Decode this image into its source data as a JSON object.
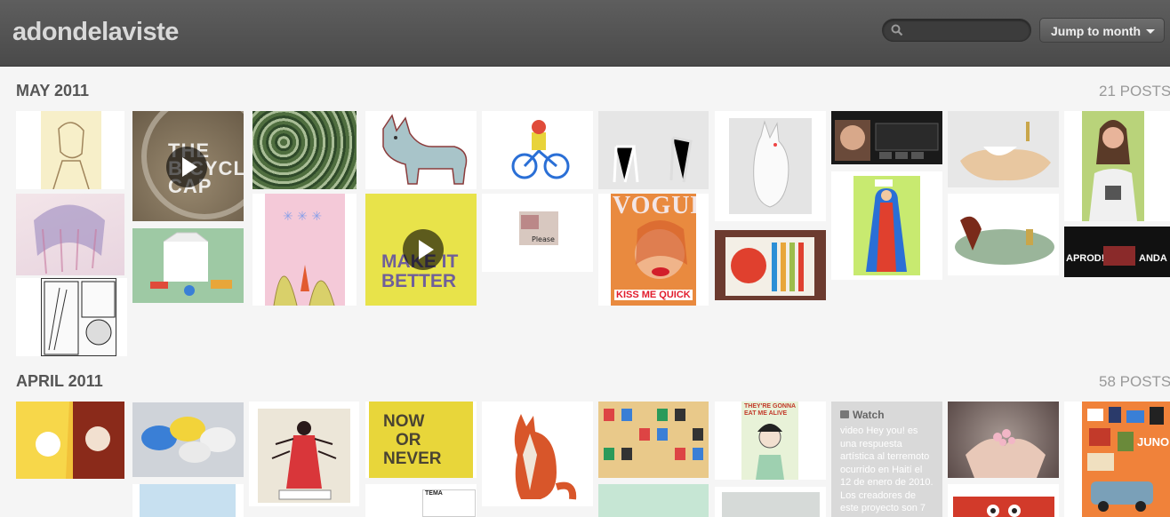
{
  "header": {
    "site_title": "adondelaviste",
    "search_placeholder": "",
    "jump_label": "Jump to month"
  },
  "sections": [
    {
      "title": "MAY 2011",
      "count": "21 POSTS"
    },
    {
      "title": "APRIL 2011",
      "count": "58 POSTS"
    }
  ],
  "tile_text": {
    "bicycle": "THE BICYCLE CAP",
    "vogue_masthead": "VOGUE",
    "vogue_cover": "KISS ME QUICK",
    "make_it_better": "MAKE IT BETTER",
    "now_or_never": [
      "NOW",
      "OR",
      "NEVER"
    ],
    "tema": "TEMA",
    "juno": "JUNO",
    "eat_me": "THEY'RE GONNA EAT ME ALIVE",
    "aprod": "APROD!",
    "anda": "ANDA"
  },
  "watch_post": {
    "title": "Watch",
    "body": "video Hey you! es una respuesta artística al terremoto ocurrido en Haití el 12 de enero de 2010. Los creadores de este proyecto son 7"
  },
  "colors": {
    "header_bg": "#4f4f4f",
    "page_bg": "#f5f5f5",
    "title_text": "#555555",
    "count_text": "#999999"
  },
  "icons": [
    "search-icon",
    "chevron-down-icon",
    "play-icon",
    "video-icon"
  ]
}
